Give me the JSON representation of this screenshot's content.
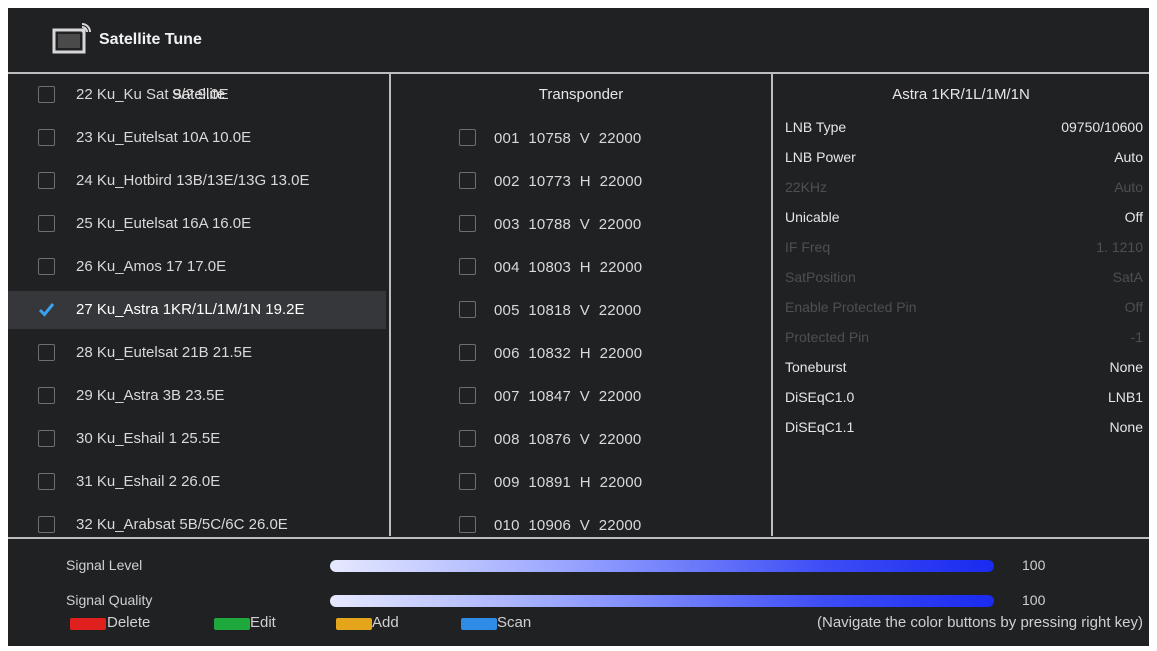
{
  "header": {
    "title": "Satellite Tune",
    "icon": "satellite-tv-icon"
  },
  "satellite_panel": {
    "title": "Satellite",
    "items": [
      {
        "label": "22  Ku_Ku Sat 9/? 9.0E",
        "checked": false
      },
      {
        "label": "23  Ku_Eutelsat 10A 10.0E",
        "checked": false
      },
      {
        "label": "24  Ku_Hotbird 13B/13E/13G 13.0E",
        "checked": false
      },
      {
        "label": "25  Ku_Eutelsat 16A 16.0E",
        "checked": false
      },
      {
        "label": "26  Ku_Amos 17 17.0E",
        "checked": false
      },
      {
        "label": "27  Ku_Astra 1KR/1L/1M/1N 19.2E",
        "checked": true
      },
      {
        "label": "28  Ku_Eutelsat 21B 21.5E",
        "checked": false
      },
      {
        "label": "29  Ku_Astra 3B 23.5E",
        "checked": false
      },
      {
        "label": "30  Ku_Eshail 1 25.5E",
        "checked": false
      },
      {
        "label": "31  Ku_Eshail 2 26.0E",
        "checked": false
      },
      {
        "label": "32  Ku_Arabsat 5B/5C/6C 26.0E",
        "checked": false
      }
    ]
  },
  "transponder_panel": {
    "title": "Transponder",
    "items": [
      "001  10758  V  22000",
      "002  10773  H  22000",
      "003  10788  V  22000",
      "004  10803  H  22000",
      "005  10818  V  22000",
      "006  10832  H  22000",
      "007  10847  V  22000",
      "008  10876  V  22000",
      "009  10891  H  22000",
      "010  10906  V  22000"
    ]
  },
  "settings_panel": {
    "title": "Astra 1KR/1L/1M/1N",
    "rows": [
      {
        "label": "LNB Type",
        "value": "09750/10600",
        "disabled": false
      },
      {
        "label": "LNB Power",
        "value": "Auto",
        "disabled": false
      },
      {
        "label": "22KHz",
        "value": "Auto",
        "disabled": true
      },
      {
        "label": "Unicable",
        "value": "Off",
        "disabled": false
      },
      {
        "label": "IF Freq",
        "value": "1. 1210",
        "disabled": true
      },
      {
        "label": "SatPosition",
        "value": "SatA",
        "disabled": true
      },
      {
        "label": "Enable Protected Pin",
        "value": "Off",
        "disabled": true
      },
      {
        "label": "Protected Pin",
        "value": "-1",
        "disabled": true
      },
      {
        "label": "Toneburst",
        "value": "None",
        "disabled": false
      },
      {
        "label": "DiSEqC1.0",
        "value": "LNB1",
        "disabled": false
      },
      {
        "label": "DiSEqC1.1",
        "value": "None",
        "disabled": false
      }
    ]
  },
  "signal": {
    "level_label": "Signal Level",
    "level_value": "100",
    "quality_label": "Signal Quality",
    "quality_value": "100"
  },
  "color_keys": [
    {
      "label": "Delete",
      "color": "#e0201c"
    },
    {
      "label": "Edit",
      "color": "#1fa83b"
    },
    {
      "label": "Add",
      "color": "#e5a51a"
    },
    {
      "label": "Scan",
      "color": "#2f8be6"
    }
  ],
  "hint": "(Navigate the color buttons by pressing right key)",
  "colors": {
    "background": "#202123",
    "divider": "#bdbdbd",
    "check": "#3aa0f0",
    "selected_row": "#35373a"
  }
}
